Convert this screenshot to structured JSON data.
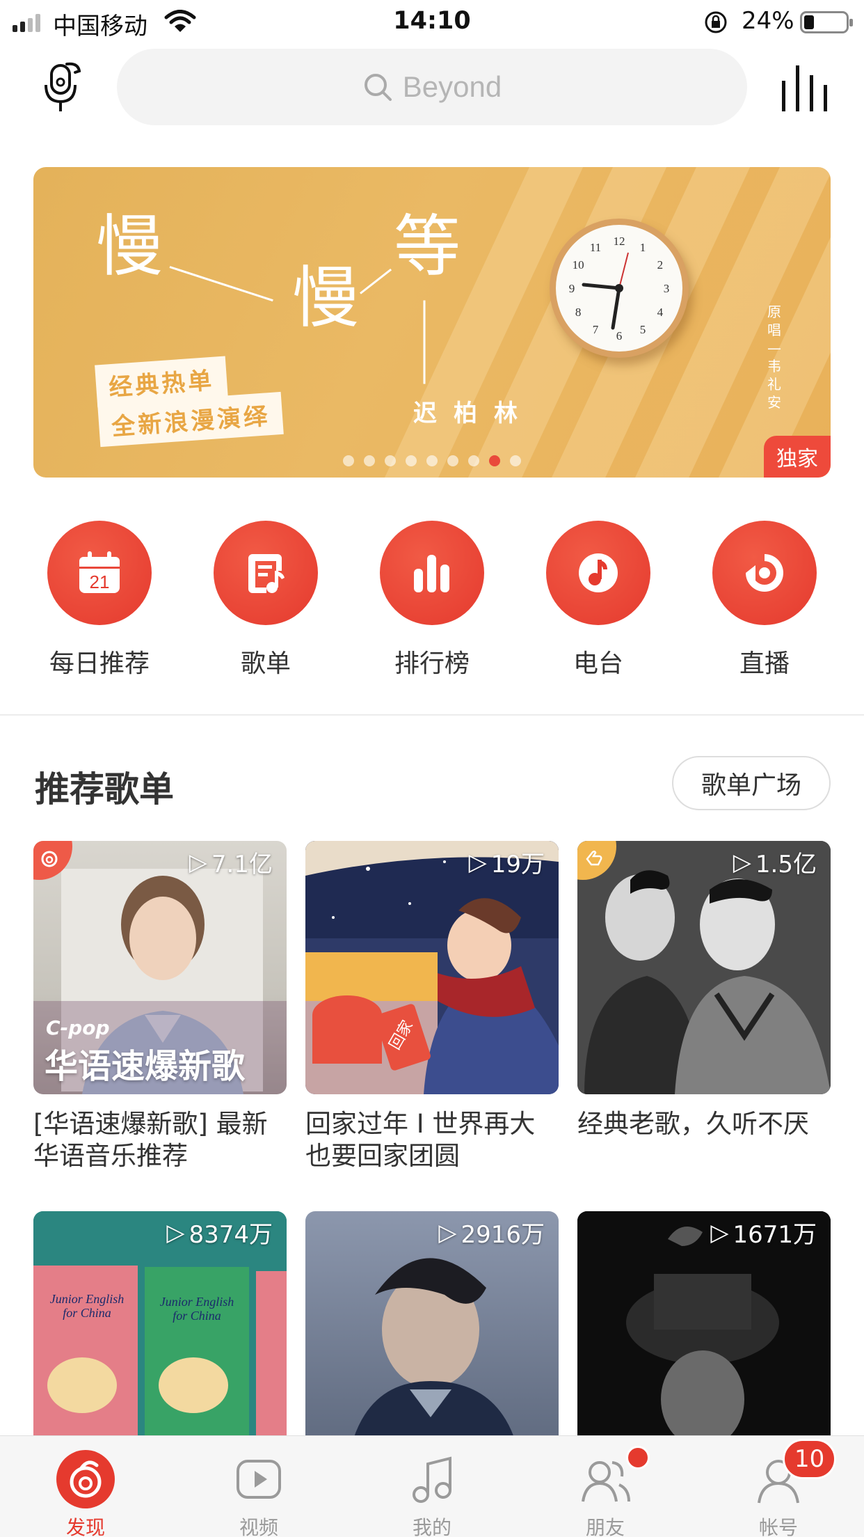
{
  "status": {
    "carrier": "中国移动",
    "time": "14:10",
    "battery": "24%",
    "battery_level": 0.24
  },
  "search": {
    "placeholder": "Beyond"
  },
  "banner": {
    "headline_chars": [
      "慢",
      "慢",
      "等"
    ],
    "tag_line1": "经典热单",
    "tag_line2": "全新浪漫演绎",
    "artist": "迟柏林",
    "original_singer_note": "原唱—韦礼安",
    "badge": "独家",
    "dot_count": 9,
    "active_dot": 7,
    "clock_numerals": [
      "12",
      "1",
      "2",
      "3",
      "4",
      "5",
      "6",
      "7",
      "8",
      "9",
      "10",
      "11"
    ]
  },
  "quick_entries": [
    {
      "label": "每日推荐",
      "icon": "calendar-icon",
      "day": "21"
    },
    {
      "label": "歌单",
      "icon": "playlist-icon"
    },
    {
      "label": "排行榜",
      "icon": "chart-bars-icon"
    },
    {
      "label": "电台",
      "icon": "radio-icon"
    },
    {
      "label": "直播",
      "icon": "live-icon"
    }
  ],
  "section": {
    "title": "推荐歌单",
    "more_button": "歌单广场"
  },
  "playlists": [
    {
      "count": "7.1亿",
      "title": "[华语速爆新歌] 最新华语音乐推荐",
      "overlay_small": "C-pop",
      "overlay_big": "华语速爆新歌",
      "corner": true
    },
    {
      "count": "19万",
      "title": "回家过年 I 世界再大也要回家团圆",
      "overlay_red": "回家"
    },
    {
      "count": "1.5亿",
      "title": "经典老歌，久听不厌",
      "corner": true
    },
    {
      "count": "8374万",
      "title": "",
      "book_title": "Junior English for China"
    },
    {
      "count": "2916万",
      "title": ""
    },
    {
      "count": "1671万",
      "title": ""
    }
  ],
  "tabs": [
    {
      "label": "发现",
      "active": true
    },
    {
      "label": "视频"
    },
    {
      "label": "我的"
    },
    {
      "label": "朋友",
      "dot": true
    },
    {
      "label": "帐号",
      "badge": "10"
    }
  ],
  "colors": {
    "accent": "#e53a2e",
    "banner": "#e8b460"
  }
}
